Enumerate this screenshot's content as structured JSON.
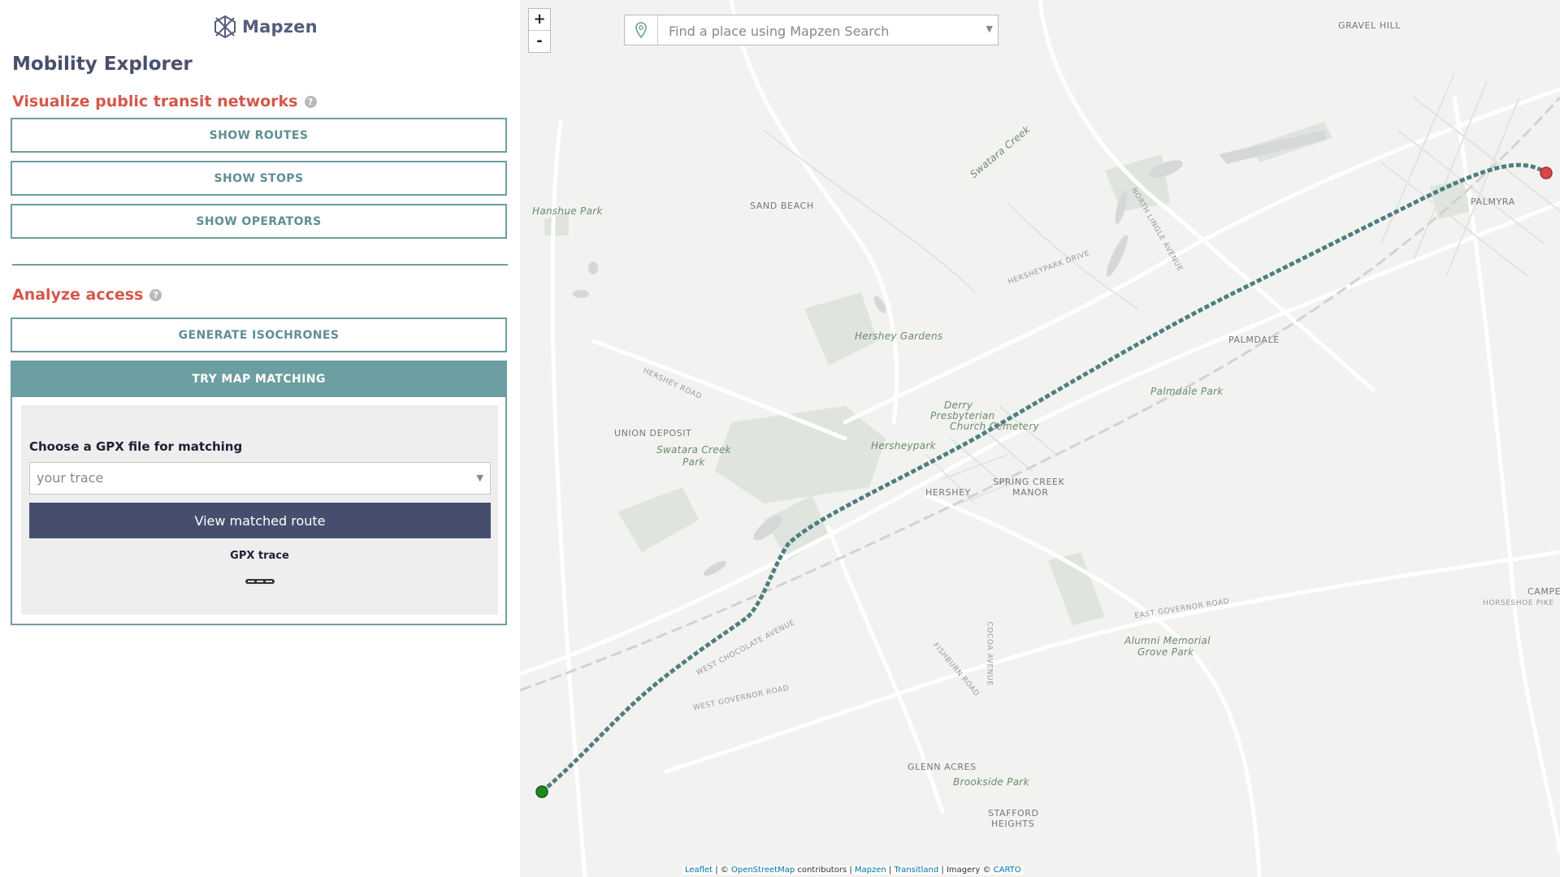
{
  "brand": {
    "logo_text": "Mapzen"
  },
  "app": {
    "title": "Mobility Explorer"
  },
  "sections": {
    "visualize": {
      "title": "Visualize public transit networks",
      "help": "?"
    },
    "analyze": {
      "title": "Analyze access",
      "help": "?"
    }
  },
  "buttons": {
    "show_routes": "SHOW ROUTES",
    "show_stops": "SHOW STOPS",
    "show_operators": "SHOW OPERATORS",
    "generate_isochrones": "GENERATE ISOCHRONES",
    "try_map_matching": "TRY MAP MATCHING"
  },
  "map_matching": {
    "choose_label": "Choose a GPX file for matching",
    "select_value": "your trace",
    "view_button": "View matched route",
    "legend_label": "GPX trace"
  },
  "map": {
    "zoom_in": "+",
    "zoom_out": "-",
    "search_placeholder": "Find a place using Mapzen Search",
    "attribution": {
      "leaflet": "Leaflet",
      "sep1": " | © ",
      "osm": "OpenStreetMap",
      "contributors": " contributors | ",
      "mapzen": "Mapzen",
      "sep2": " | ",
      "transitland": "Transitland",
      "imagery": " | Imagery © ",
      "carto": "CARTO"
    },
    "labels": {
      "gravel_hill": "GRAVEL HILL",
      "hanshue_park": "Hanshue Park",
      "sand_beach": "SAND BEACH",
      "hershey_gardens": "Hershey Gardens",
      "palmyra": "PALMYRA",
      "palmdale": "PALMDALE",
      "palmdale_park": "Palmdale Park",
      "union_deposit": "UNION DEPOSIT",
      "swatara_creek_park_1": "Swatara Creek",
      "swatara_creek_park_2": "Park",
      "derry_1": "Derry",
      "derry_2": "Presbyterian",
      "derry_3": "Church Cemetery",
      "hersheypark": "Hersheypark",
      "hershey": "HERSHEY",
      "spring_creek_1": "SPRING CREEK",
      "spring_creek_2": "MANOR",
      "alumni_1": "Alumni Memorial",
      "alumni_2": "Grove Park",
      "glenn_acres": "GLENN ACRES",
      "brookside_park": "Brookside Park",
      "stafford_1": "STAFFORD",
      "stafford_2": "HEIGHTS",
      "hersheypark_drive": "HERSHEYPARK DRIVE",
      "east_governor_road": "EAST GOVERNOR ROAD",
      "west_governor_road": "WEST GOVERNOR ROAD",
      "west_chocolate_avenue": "WEST CHOCOLATE AVENUE",
      "north_lingle_avenue": "NORTH LINGLE AVENUE",
      "fishburn_road": "FISHBURN ROAD",
      "cocoa_avenue": "COCOA AVENUE",
      "hershey_road": "HERSHEY ROAD",
      "swatara_creek": "Swatara Creek",
      "horseshoe_pike": "HORSESHOE PIKE",
      "campe": "CAMPE"
    }
  },
  "colors": {
    "accent": "#6d9ea1",
    "section_title": "#d5574b",
    "view_button": "#454e6c",
    "trace_start": "#1e8a1e",
    "trace_end": "#d9454a",
    "trace_line": "#4e7e80"
  }
}
